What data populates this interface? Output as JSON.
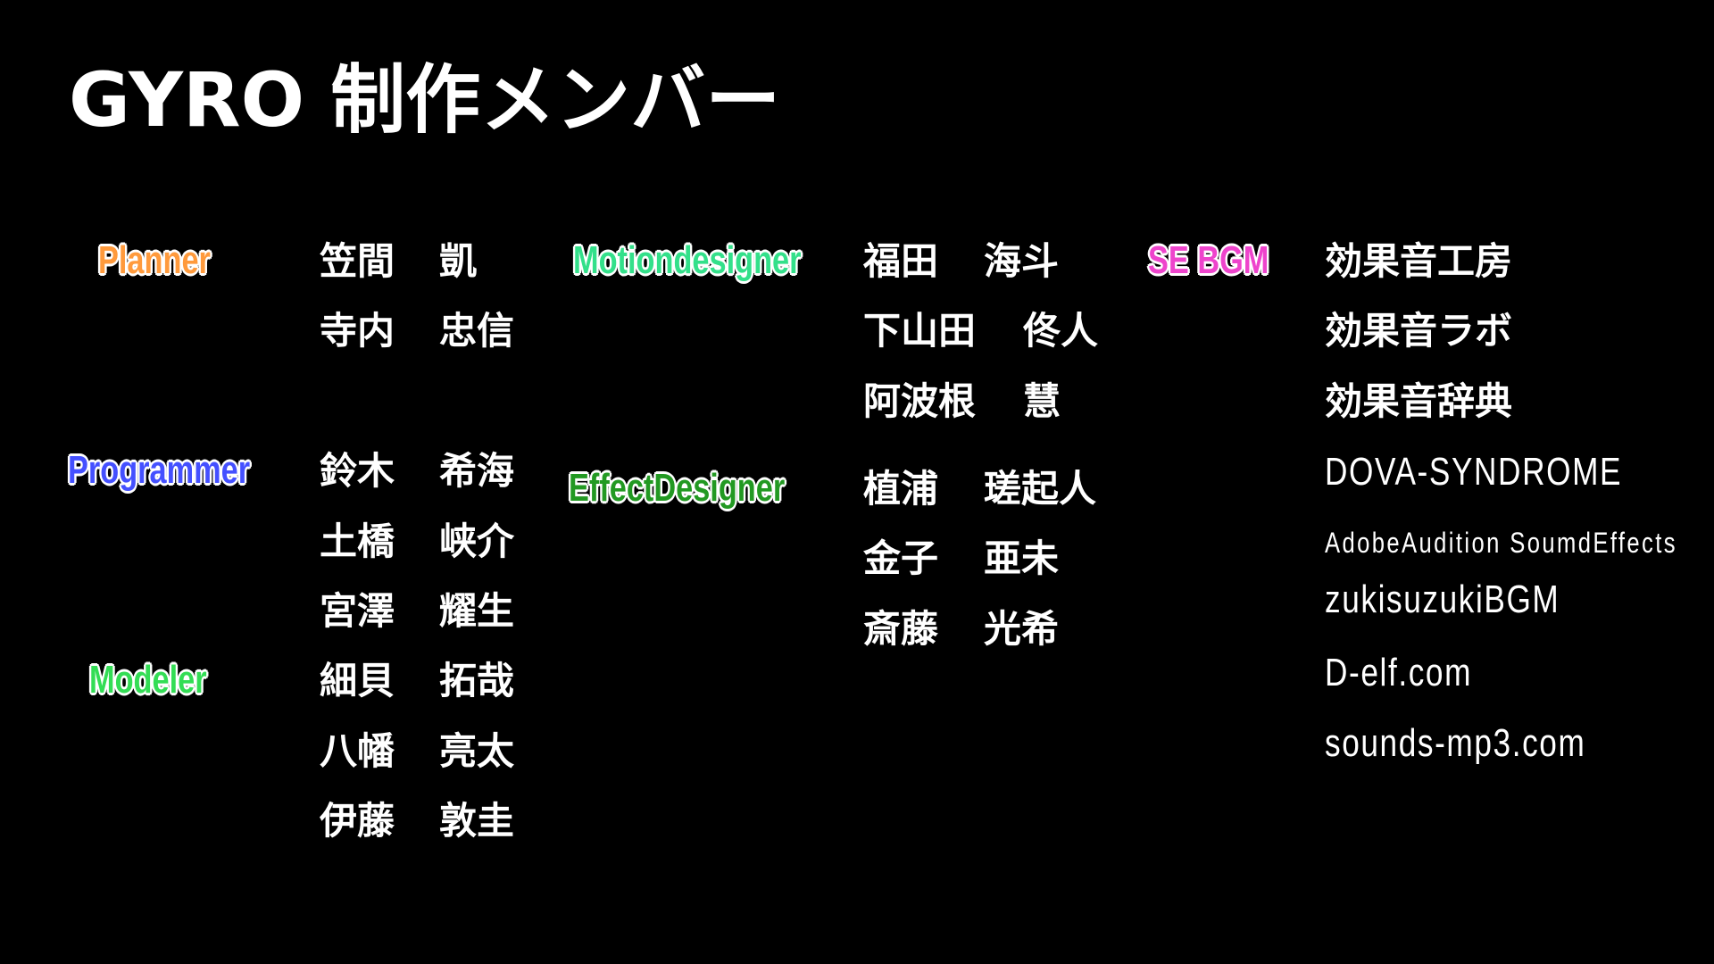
{
  "title": "GYRO 制作メンバー",
  "roles": {
    "planner": {
      "label": "Planner",
      "color": "#ff9a3c",
      "members": [
        [
          "笠間",
          "凱"
        ],
        [
          "寺内",
          "忠信"
        ]
      ]
    },
    "programmer": {
      "label": "Programmer",
      "color": "#4450ff",
      "members": [
        [
          "鈴木",
          "希海"
        ],
        [
          "土橋",
          "峡介"
        ],
        [
          "宮澤",
          "耀生"
        ]
      ]
    },
    "modeler": {
      "label": "Modeler",
      "color": "#33dd55",
      "members": [
        [
          "細貝",
          "拓哉"
        ],
        [
          "八幡",
          "亮太"
        ],
        [
          "伊藤",
          "敦圭"
        ]
      ]
    },
    "motiondesigner": {
      "label": "Motiondesigner",
      "color": "#33e08a",
      "members": [
        [
          "福田",
          "海斗"
        ],
        [
          "下山田",
          "佟人"
        ],
        [
          "阿波根",
          "慧"
        ]
      ]
    },
    "effectdesigner": {
      "label": "EffectDesigner",
      "color": "#229922",
      "members": [
        [
          "植浦",
          "瑳起人"
        ],
        [
          "金子",
          "亜未"
        ],
        [
          "斎藤",
          "光希"
        ]
      ]
    },
    "se_bgm": {
      "label": "SE BGM",
      "color": "#ee44cc",
      "sources": [
        "効果音工房",
        "効果音ラボ",
        "効果音辞典",
        "DOVA-SYNDROME",
        "AdobeAudition SoumdEffects",
        "zukisuzukiBGM",
        "D-elf.com",
        "sounds-mp3.com"
      ]
    }
  }
}
